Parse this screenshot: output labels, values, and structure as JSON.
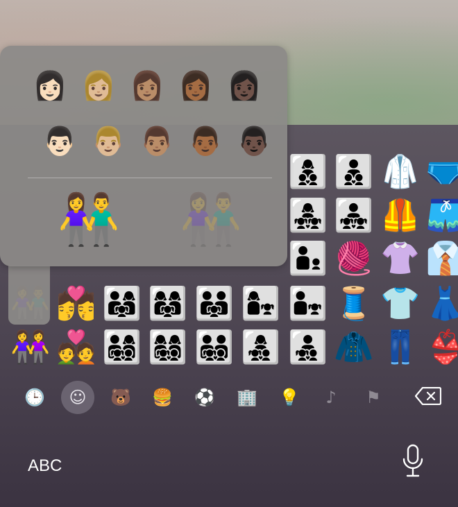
{
  "keyboard": {
    "abc_label": "ABC"
  },
  "popup": {
    "women_row": [
      "👩🏻",
      "👩🏼",
      "👩🏽",
      "👩🏾",
      "👩🏿"
    ],
    "men_row": [
      "👨🏻",
      "👨🏼",
      "👨🏽",
      "👨🏾",
      "👨🏿"
    ],
    "selected_emoji": "👫",
    "ghost_emoji": "👫"
  },
  "grid": {
    "row1": [
      "👩‍👦‍👦",
      "👨‍👦‍👦",
      "🥼",
      "🩲"
    ],
    "row2": [
      "👩‍👧‍👧",
      "👨‍👧‍👧",
      "🦺",
      "🩳"
    ],
    "row3": [
      "👨‍👦",
      "🧶",
      "👚",
      "👔"
    ],
    "row4": [
      "👫",
      "💏",
      "👨‍👩‍👧",
      "👩‍👩‍👧",
      "👨‍👨‍👧",
      "👩‍👧",
      "👨‍👧",
      "🧵",
      "👕",
      "👗"
    ],
    "row5": [
      "👭",
      "💑",
      "👨‍👩‍👧‍👦",
      "👩‍👩‍👧‍👦",
      "👨‍👨‍👧‍👦",
      "👩‍👧‍👦",
      "👨‍👧‍👦",
      "🧥",
      "👖",
      "👙"
    ]
  },
  "categories": [
    {
      "name": "recent",
      "glyph": "🕒"
    },
    {
      "name": "smileys",
      "glyph": "☺"
    },
    {
      "name": "animals",
      "glyph": "🐻"
    },
    {
      "name": "food",
      "glyph": "🍔"
    },
    {
      "name": "activity",
      "glyph": "⚽"
    },
    {
      "name": "travel",
      "glyph": "🏢"
    },
    {
      "name": "objects",
      "glyph": "💡"
    },
    {
      "name": "symbols",
      "glyph": "♪"
    },
    {
      "name": "flags",
      "glyph": "⚑"
    }
  ],
  "colors": {
    "keyboard_bg": "#4b4350",
    "popup_bg": "#8c8a88",
    "active_category": "#6a6370",
    "icon_gray": "#8f8a93"
  }
}
